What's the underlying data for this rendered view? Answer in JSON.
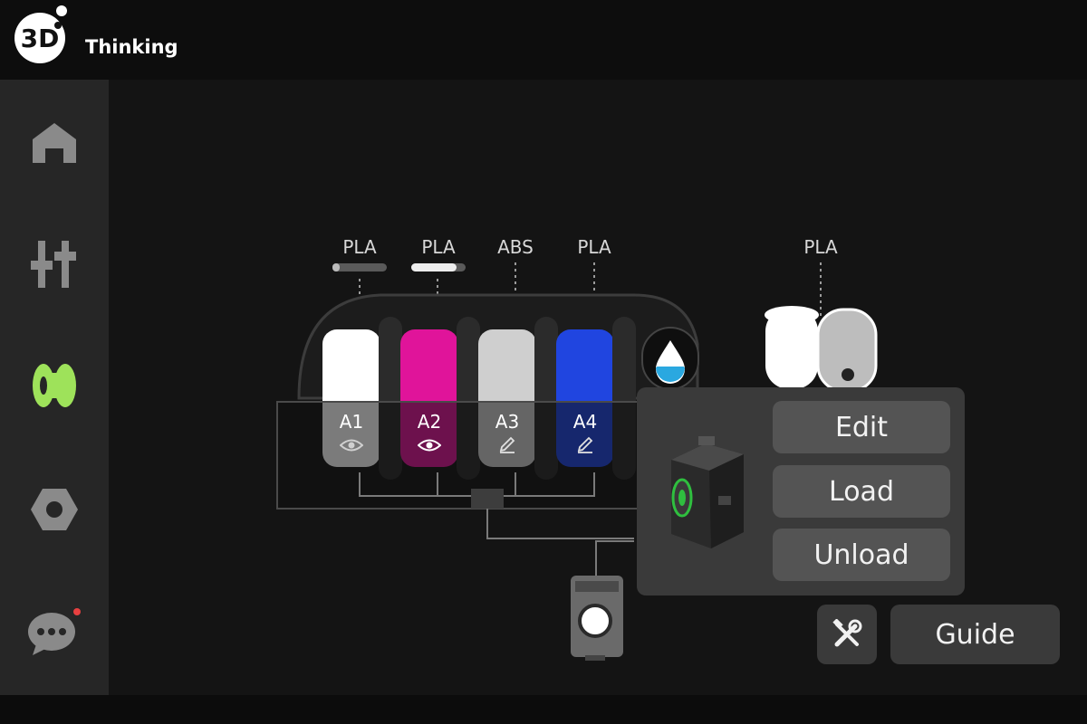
{
  "app": {
    "logo_text": "3D Thinking",
    "logo_mark": "3D",
    "logo_word": "Thinking"
  },
  "sidebar": {
    "items": [
      {
        "name": "home",
        "icon": "home-icon"
      },
      {
        "name": "controls",
        "icon": "sliders-icon"
      },
      {
        "name": "filament",
        "icon": "spool-icon",
        "active": true
      },
      {
        "name": "settings",
        "icon": "hex-nut-icon"
      },
      {
        "name": "messages",
        "icon": "chat-bubble-icon",
        "has_notification": true
      }
    ]
  },
  "ams": {
    "slots": [
      {
        "id": "A1",
        "material": "PLA",
        "color": "#ffffff",
        "status_icon": "eye-icon"
      },
      {
        "id": "A2",
        "material": "PLA",
        "color": "#e0149a",
        "status_icon": "eye-icon"
      },
      {
        "id": "A3",
        "material": "ABS",
        "color": "#cfcfcf",
        "status_icon": "pencil-icon"
      },
      {
        "id": "A4",
        "material": "PLA",
        "color": "#2045e0",
        "status_icon": "pencil-icon"
      }
    ],
    "humidity_icon": "humidity-drop-icon"
  },
  "external_spool": {
    "material": "PLA",
    "color": "#ffffff"
  },
  "popup": {
    "edit_label": "Edit",
    "load_label": "Load",
    "unload_label": "Unload"
  },
  "footer": {
    "guide_label": "Guide",
    "tool_icon": "tools-icon"
  },
  "colors": {
    "accent": "#9ee25a",
    "notification": "#e84040",
    "panel": "#3a3a3a",
    "button": "#545454",
    "humidity": "#2aa8e0"
  }
}
